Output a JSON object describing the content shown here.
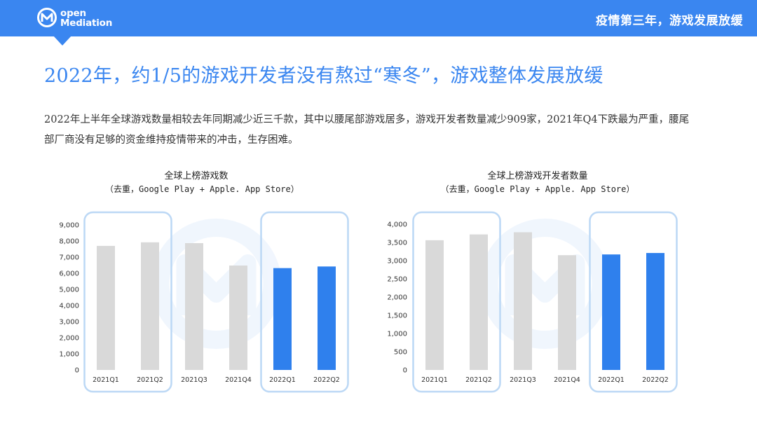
{
  "header": {
    "logo_line1": "open",
    "logo_line2": "Mediation",
    "right_title": "疫情第三年，游戏发展放缓"
  },
  "title": "2022年，约1/5的游戏开发者没有熬过“寒冬”，游戏整体发展放缓",
  "description": "2022年上半年全球游戏数量相较去年同期减少近三千款，其中以腰尾部游戏居多，游戏开发者数量减少909家，2021年Q4下跌最为严重，腰尾部厂商没有足够的资金维持疫情带来的冲击，生存困难。",
  "colors": {
    "accent": "#3a86f0",
    "bar_gray": "#d9d9d9",
    "bar_blue": "#2f80ed",
    "frame": "#bcd8f5"
  },
  "chart_data": [
    {
      "type": "bar",
      "title": "全球上榜游戏数",
      "subtitle": "（去重，Google Play + Apple. App Store）",
      "categories": [
        "2021Q1",
        "2021Q2",
        "2021Q3",
        "2021Q4",
        "2022Q1",
        "2022Q2"
      ],
      "values": [
        7700,
        7920,
        7870,
        6480,
        6320,
        6420
      ],
      "bar_colors": [
        "gray",
        "gray",
        "gray",
        "gray",
        "blue",
        "blue"
      ],
      "yticks": [
        "0",
        "1,000",
        "2,000",
        "3,000",
        "4,000",
        "5,000",
        "6,000",
        "7,000",
        "8,000",
        "9,000"
      ],
      "ylim": [
        0,
        9000
      ],
      "highlight_groups": [
        [
          0,
          1
        ],
        [
          4,
          5
        ]
      ]
    },
    {
      "type": "bar",
      "title": "全球上榜游戏开发者数量",
      "subtitle": "（去重，Google Play + Apple. App Store）",
      "categories": [
        "2021Q1",
        "2021Q2",
        "2021Q3",
        "2021Q4",
        "2022Q1",
        "2022Q2"
      ],
      "values": [
        3560,
        3720,
        3780,
        3150,
        3170,
        3210
      ],
      "bar_colors": [
        "gray",
        "gray",
        "gray",
        "gray",
        "blue",
        "blue"
      ],
      "yticks": [
        "0",
        "500",
        "1,000",
        "1,500",
        "2,000",
        "2,500",
        "3,000",
        "3,500",
        "4,000"
      ],
      "ylim": [
        0,
        4000
      ],
      "highlight_groups": [
        [
          0,
          1
        ],
        [
          4,
          5
        ]
      ]
    }
  ]
}
